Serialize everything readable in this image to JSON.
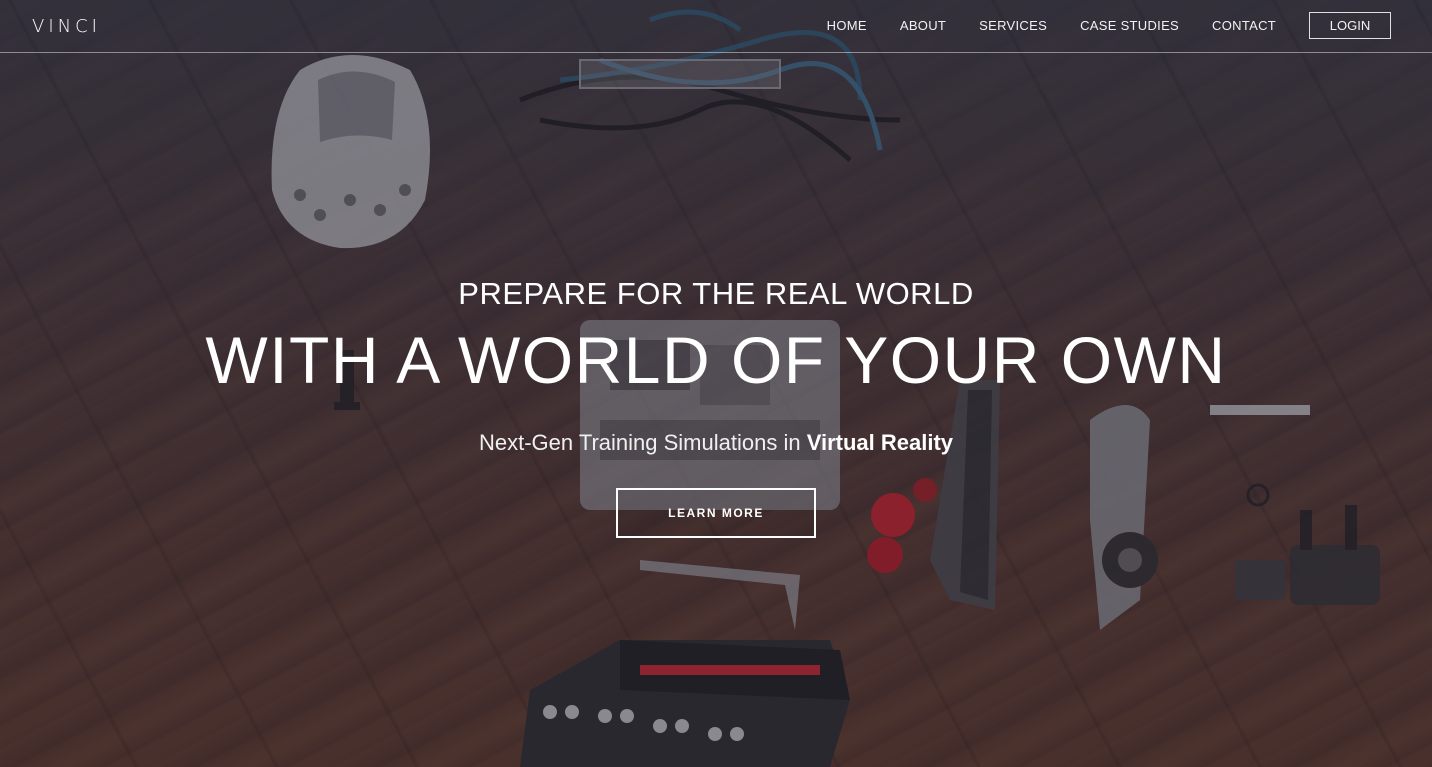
{
  "brand": {
    "logo_text": "VINCI"
  },
  "nav": {
    "items": [
      {
        "label": "HOME"
      },
      {
        "label": "ABOUT"
      },
      {
        "label": "SERVICES"
      },
      {
        "label": "CASE STUDIES"
      },
      {
        "label": "CONTACT"
      }
    ],
    "login_label": "LOGIN"
  },
  "hero": {
    "line1": "PREPARE FOR THE REAL WORLD",
    "line2": "WITH A WORLD OF YOUR OWN",
    "subtitle_prefix": "Next-Gen Training Simulations in ",
    "subtitle_emphasis": "Virtual Reality",
    "cta_label": "LEARN MORE"
  },
  "colors": {
    "text": "#ffffff",
    "floor": "#6b3b2c",
    "overlay": "#2c2834"
  }
}
